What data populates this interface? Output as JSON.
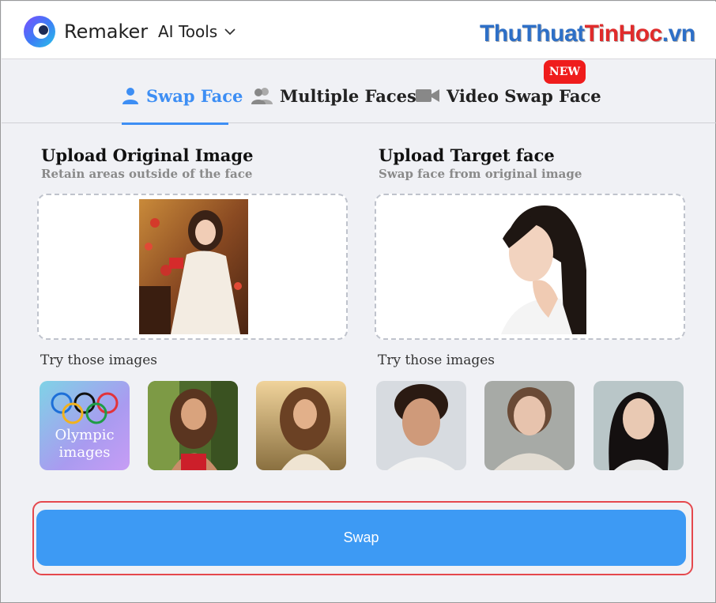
{
  "header": {
    "brand": "Remaker",
    "menu_label": "AI Tools",
    "watermark_part1": "ThuThuat",
    "watermark_part2": "TinHoc",
    "watermark_part3": ".vn"
  },
  "tabs": [
    {
      "label": "Swap Face",
      "icon": "user-icon",
      "active": true
    },
    {
      "label": "Multiple Faces",
      "icon": "users-icon",
      "active": false
    },
    {
      "label": "Video Swap Face",
      "icon": "video-camera-icon",
      "active": false
    }
  ],
  "badge": {
    "new_label": "NEW"
  },
  "original": {
    "title": "Upload Original Image",
    "subtitle": "Retain areas outside of the face",
    "try_label": "Try those images",
    "samples": [
      {
        "kind": "olympic",
        "label_line1": "Olympic",
        "label_line2": "images"
      },
      {
        "kind": "photo",
        "desc": "woman-red-dress"
      },
      {
        "kind": "photo",
        "desc": "woman-sunset"
      }
    ]
  },
  "target": {
    "title": "Upload Target face",
    "subtitle": "Swap face from original image",
    "try_label": "Try those images",
    "samples": [
      {
        "kind": "photo",
        "desc": "man-curly-hair"
      },
      {
        "kind": "photo",
        "desc": "woman-sweater"
      },
      {
        "kind": "photo",
        "desc": "woman-dark-hair"
      }
    ]
  },
  "swap": {
    "label": "Swap"
  },
  "colors": {
    "accent": "#3d8ef4",
    "badge": "#ef1c1c",
    "highlight": "#e5484d"
  }
}
